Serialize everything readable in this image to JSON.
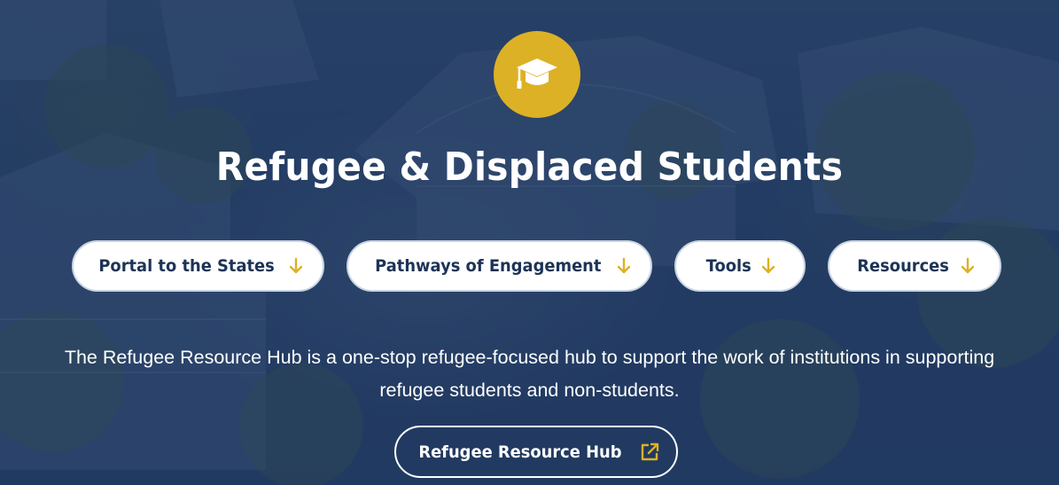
{
  "hero": {
    "icon": "graduation-cap-icon",
    "title": "Refugee & Displaced Students",
    "accent_color": "#dcb126",
    "nav_buttons": [
      {
        "label": "Portal to the States",
        "icon": "arrow-down-icon"
      },
      {
        "label": "Pathways of Engagement",
        "icon": "arrow-down-icon"
      },
      {
        "label": "Tools",
        "icon": "arrow-down-icon"
      },
      {
        "label": "Resources",
        "icon": "arrow-down-icon"
      }
    ],
    "description_line1": "The Refugee Resource Hub is a one-stop refugee-focused hub to support the work of institutions in supporting",
    "description_line2": "refugee students and non-students.",
    "cta": {
      "label": "Refugee Resource Hub",
      "icon": "external-link-icon"
    }
  }
}
